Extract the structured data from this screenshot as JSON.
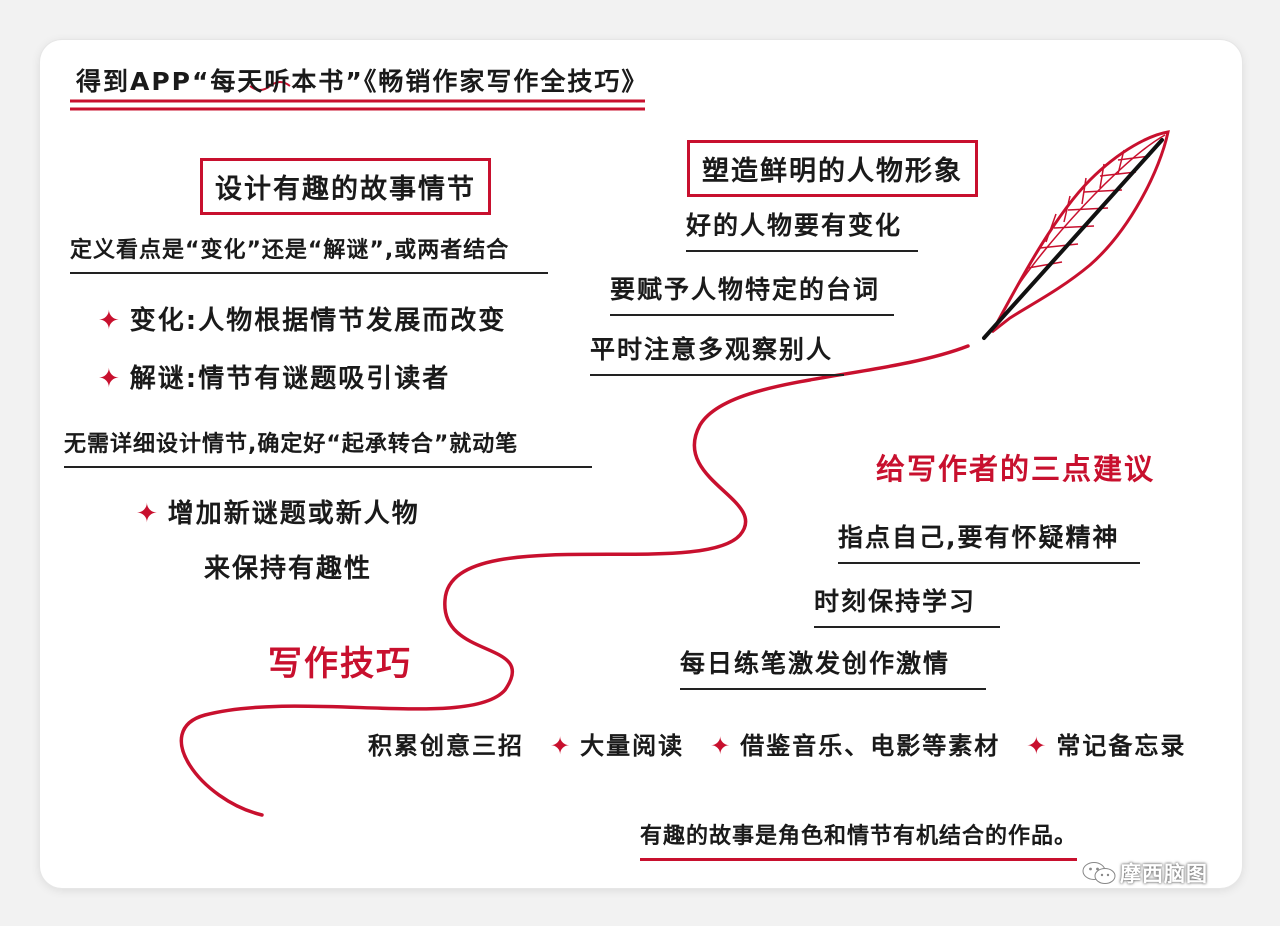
{
  "header": {
    "title": "得到APP“每天听本书”《畅销作家写作全技巧》"
  },
  "left": {
    "box_title": "设计有趣的故事情节",
    "definition": "定义看点是“变化”还是“解谜”,或两者结合",
    "points": [
      "变化:人物根据情节发展而改变",
      "解谜:情节有谜题吸引读者"
    ],
    "no_need": "无需详细设计情节,确定好“起承转合”就动笔",
    "add_line1": "增加新谜题或新人物",
    "add_line2": "来保持有趣性"
  },
  "right_top": {
    "box_title": "塑造鲜明的人物形象",
    "items": [
      "好的人物要有变化",
      "要赋予人物特定的台词",
      "平时注意多观察别人"
    ]
  },
  "suggestions": {
    "title": "给写作者的三点建议",
    "items": [
      "指点自己,要有怀疑精神",
      "时刻保持学习",
      "每日练笔激发创作激情"
    ]
  },
  "center": {
    "label": "写作技巧"
  },
  "creativity": {
    "label": "积累创意三招",
    "items": [
      "大量阅读",
      "借鉴音乐、电影等素材",
      "常记备忘录"
    ]
  },
  "conclusion": "有趣的故事是角色和情节有机结合的作品。",
  "watermark": {
    "icon": "wechat-icon",
    "text": "摩西脑图"
  },
  "colors": {
    "accent": "#c8102e",
    "ink": "#1a1a1a"
  }
}
